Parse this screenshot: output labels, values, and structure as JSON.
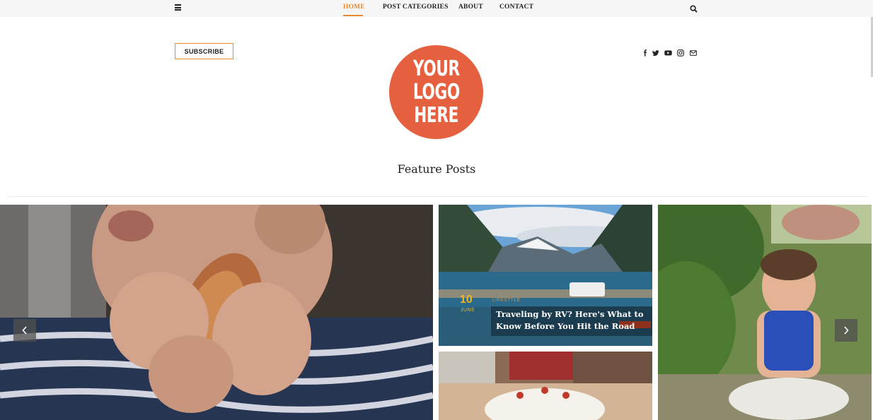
{
  "nav": {
    "items": [
      {
        "label": "HOME",
        "active": true
      },
      {
        "label": "POST CATEGORIES",
        "active": false
      },
      {
        "label": "ABOUT",
        "active": false
      },
      {
        "label": "CONTACT",
        "active": false
      }
    ]
  },
  "header": {
    "subscribe_label": "SUBSCRIBE",
    "logo_lines": [
      "YOUR",
      "LOGO",
      "HERE"
    ],
    "social_icons": [
      "facebook-icon",
      "twitter-icon",
      "youtube-icon",
      "instagram-icon",
      "mail-icon"
    ]
  },
  "section": {
    "title": "Feature Posts"
  },
  "posts": {
    "rv": {
      "day": "10",
      "month": "JUNE",
      "category": "LIFESTYLE",
      "title": "Traveling by RV? Here's What to Know Before You Hit the Road"
    }
  },
  "colors": {
    "accent": "#e88a2e",
    "logo_bg": "#e5603f",
    "date": "#f0b51f"
  }
}
